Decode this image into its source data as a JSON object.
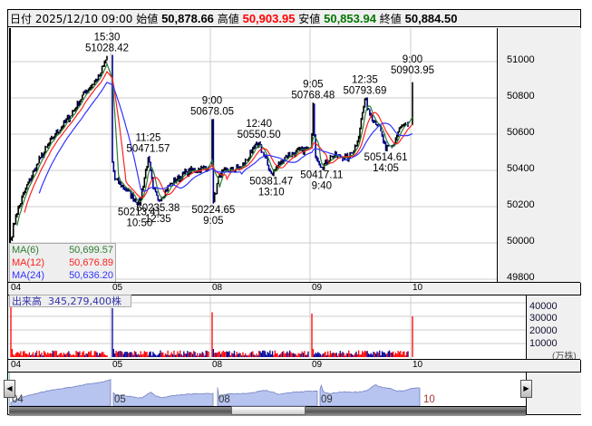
{
  "header": {
    "date_label": "日付",
    "date": "2025/12/10 09:00",
    "open_label": "始値",
    "open": "50,878.66",
    "high_label": "高値",
    "high": "50,903.95",
    "low_label": "安値",
    "low": "50,853.94",
    "close_label": "終値",
    "close": "50,884.50"
  },
  "colors": {
    "high": "#ff0000",
    "low": "#007000",
    "ma6": "#2e7d32",
    "ma12": "#ff2020",
    "ma24": "#3333ff",
    "up": "#000000",
    "down": "#00008b",
    "vol_up": "#ff0000",
    "vol_down": "#000099",
    "nav_fill": "#b8c4f0",
    "nav_line": "#7080c0"
  },
  "ma_legend": [
    {
      "name": "MA(6)",
      "value": "50,699.57"
    },
    {
      "name": "MA(12)",
      "value": "50,676.89"
    },
    {
      "name": "MA(24)",
      "value": "50,636.20"
    }
  ],
  "volume": {
    "label": "出来高",
    "value": "345,279,400株",
    "unit": "(万株)",
    "ticks": [
      "40000",
      "30000",
      "20000",
      "10000"
    ]
  },
  "days": [
    "04",
    "05",
    "08",
    "09",
    "10"
  ],
  "nav_days": [
    "04",
    "05",
    "08",
    "09",
    "10"
  ],
  "chart_data": {
    "type": "line",
    "title": "日経平均 5分足",
    "ylim": [
      49800,
      51100
    ],
    "yticks": [
      "51000",
      "50800",
      "50600",
      "50400",
      "50200",
      "50000",
      "49800"
    ],
    "keypoints": [
      [
        [
          0,
          50020
        ],
        [
          20,
          50150
        ],
        [
          60,
          50300
        ],
        [
          120,
          50470
        ],
        [
          180,
          50600
        ],
        [
          240,
          50700
        ],
        [
          300,
          50830
        ],
        [
          360,
          50920
        ],
        [
          390,
          51028.42
        ]
      ],
      [
        [
          0,
          50450
        ],
        [
          10,
          50350
        ],
        [
          60,
          50290
        ],
        [
          110,
          50213.41
        ],
        [
          145,
          50471.57
        ],
        [
          165,
          50300
        ],
        [
          185,
          50235.38
        ],
        [
          240,
          50330
        ],
        [
          300,
          50390
        ],
        [
          390,
          50420
        ]
      ],
      [
        [
          0,
          50678.05
        ],
        [
          5,
          50224.65
        ],
        [
          30,
          50380
        ],
        [
          120,
          50420
        ],
        [
          160,
          50500
        ],
        [
          190,
          50550.5
        ],
        [
          240,
          50381.47
        ],
        [
          300,
          50480
        ],
        [
          390,
          50520
        ]
      ],
      [
        [
          0,
          50600
        ],
        [
          5,
          50768.48
        ],
        [
          12,
          50500
        ],
        [
          40,
          50417.11
        ],
        [
          80,
          50480
        ],
        [
          150,
          50470
        ],
        [
          185,
          50560
        ],
        [
          215,
          50793.69
        ],
        [
          240,
          50700
        ],
        [
          270,
          50650
        ],
        [
          300,
          50514.61
        ],
        [
          330,
          50540
        ],
        [
          360,
          50640
        ],
        [
          390,
          50650
        ]
      ],
      [
        [
          0,
          50884.5
        ]
      ]
    ],
    "annotations": [
      {
        "day": 0,
        "min": 390,
        "time": "15:30",
        "value": "51028.42",
        "kind": "high"
      },
      {
        "day": 1,
        "min": 110,
        "time": "10:50",
        "value": "50213.41",
        "kind": "low"
      },
      {
        "day": 1,
        "min": 145,
        "time": "11:25",
        "value": "50471.57",
        "kind": "high"
      },
      {
        "day": 1,
        "min": 185,
        "time": "12:35",
        "value": "50235.38",
        "kind": "low"
      },
      {
        "day": 2,
        "min": 0,
        "time": "9:00",
        "value": "50678.05",
        "kind": "high"
      },
      {
        "day": 2,
        "min": 5,
        "time": "9:05",
        "value": "50224.65",
        "kind": "low"
      },
      {
        "day": 2,
        "min": 190,
        "time": "12:40",
        "value": "50550.50",
        "kind": "high"
      },
      {
        "day": 2,
        "min": 240,
        "time": "13:10",
        "value": "50381.47",
        "kind": "low"
      },
      {
        "day": 3,
        "min": 5,
        "time": "9:05",
        "value": "50768.48",
        "kind": "high"
      },
      {
        "day": 3,
        "min": 40,
        "time": "9:40",
        "value": "50417.11",
        "kind": "low"
      },
      {
        "day": 3,
        "min": 215,
        "time": "12:35",
        "value": "50793.69",
        "kind": "high"
      },
      {
        "day": 3,
        "min": 300,
        "time": "14:05",
        "value": "50514.61",
        "kind": "low"
      },
      {
        "day": 4,
        "min": 0,
        "time": "9:00",
        "value": "50903.95",
        "kind": "high"
      }
    ],
    "open_volumes": [
      38000,
      36000,
      33000,
      32000,
      30000
    ],
    "vol_ylim": [
      0,
      44000
    ]
  }
}
